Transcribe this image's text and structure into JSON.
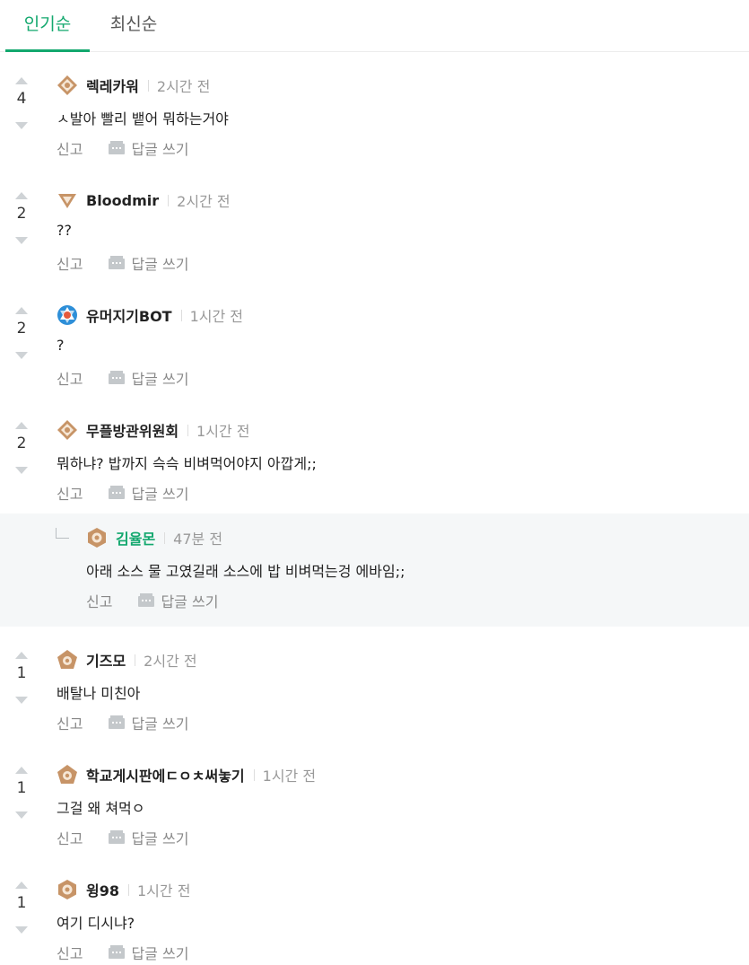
{
  "tabs": [
    {
      "label": "인기순",
      "active": true
    },
    {
      "label": "최신순",
      "active": false
    }
  ],
  "actions": {
    "report": "신고",
    "reply": "답글 쓰기"
  },
  "colors": {
    "accent": "#13a86e",
    "reply_bg": "#f5f7f8",
    "muted": "#999999"
  },
  "comments": [
    {
      "votes": "4",
      "badge": "diamond-badge-icon",
      "author": "렉레카워",
      "time": "2시간 전",
      "text": "ㅅ발아 빨리 뱉어 뭐하는거야"
    },
    {
      "votes": "2",
      "badge": "triangle-badge-icon",
      "author": "Bloodmir",
      "time": "2시간 전",
      "text": "??"
    },
    {
      "votes": "2",
      "badge": "bot-emblem-icon",
      "author": "유머지기BOT",
      "time": "1시간 전",
      "text": "?"
    },
    {
      "votes": "2",
      "badge": "diamond-badge-icon",
      "author": "무플방관위원회",
      "time": "1시간 전",
      "text": "뭐하냐? 밥까지 슥슥 비벼먹어야지 아깝게;;"
    },
    {
      "reply": true,
      "badge": "hexagon-badge-icon",
      "author": "김율몬",
      "time": "47분 전",
      "text": "아래 소스 물 고였길래 소스에 밥 비벼먹는겅 에바임;;"
    },
    {
      "votes": "1",
      "badge": "pentagon-badge-icon",
      "author": "기즈모",
      "time": "2시간 전",
      "text": "배탈나 미친아"
    },
    {
      "votes": "1",
      "badge": "pentagon-badge-icon",
      "author": "학교게시판에ㄷㅇㅊ써놓기",
      "time": "1시간 전",
      "text": "그걸 왜 쳐먹ㅇ"
    },
    {
      "votes": "1",
      "badge": "hexagon-badge-icon",
      "author": "윙98",
      "time": "1시간 전",
      "text": "여기 디시냐?"
    }
  ]
}
